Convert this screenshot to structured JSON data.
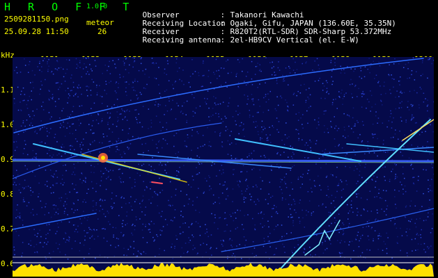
{
  "header": {
    "app_title": "H R O F F T",
    "version": "1.0.0",
    "filename": "2509281150.png",
    "datetime": "25.09.28 11:50",
    "meteor_label": "meteor",
    "meteor_count": "26"
  },
  "info": [
    {
      "key": "Observer",
      "sep": ":",
      "value": "Takanori Kawachi"
    },
    {
      "key": "Receiving Location",
      "sep": ":",
      "value": "Ogaki, Gifu, JAPAN (136.60E, 35.35N)"
    },
    {
      "key": "Receiver",
      "sep": ":",
      "value": "R820T2(RTL-SDR) SDR-Sharp 53.372MHz"
    },
    {
      "key": "Receiving antenna",
      "sep": ":",
      "value": "2el-HB9CV Vertical (el. E-W)"
    }
  ],
  "axes": {
    "y_unit": "kHz",
    "time_ticks": [
      "1151",
      "1152",
      "1153",
      "1154",
      "1155",
      "1156",
      "1157",
      "1158",
      "1159",
      "1200"
    ],
    "freq_ticks": [
      "1.1",
      "1.0",
      "0.9",
      "0.8",
      "0.7",
      "0.6"
    ]
  },
  "colors": {
    "background": "#000000",
    "title_green": "#00ff00",
    "axis_yellow": "#ffff00",
    "text_white": "#ffffff",
    "noise_blue": "#1a2a9a",
    "trace_cyan": "#40c0ff",
    "strong_yellow": "#ffe000"
  }
}
